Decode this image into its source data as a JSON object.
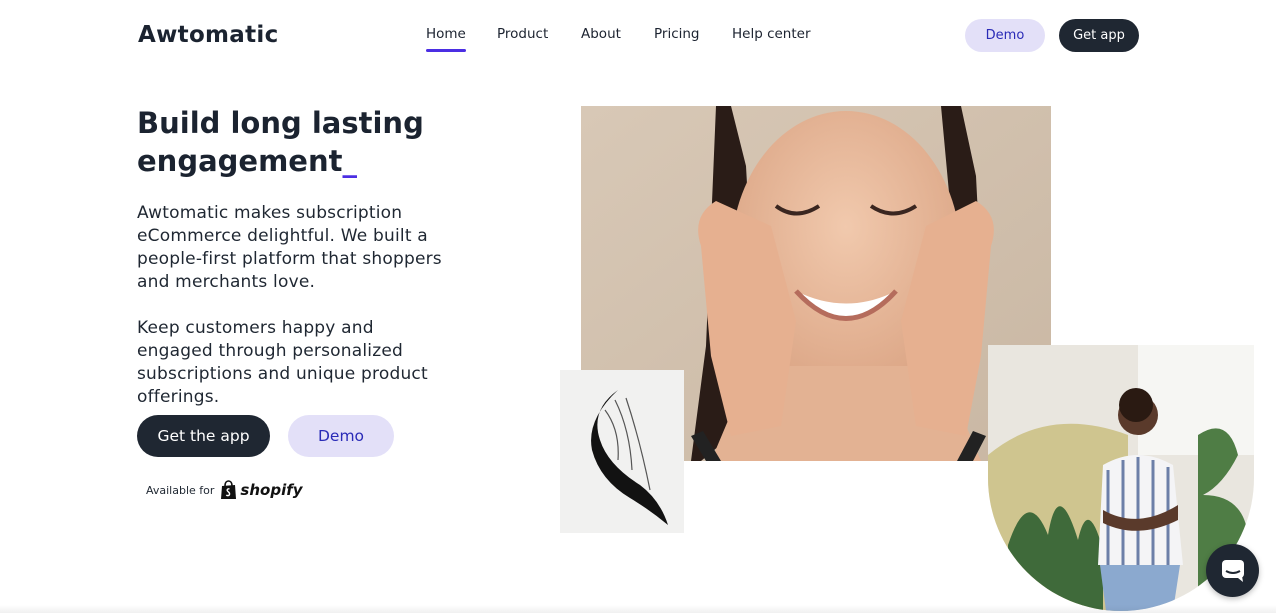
{
  "brand": {
    "logo_text": "Awtomatic",
    "accent_color": "#4b2ee3",
    "dark_color": "#1f2732",
    "soft_color": "#e3e0f8"
  },
  "nav": {
    "items": [
      {
        "label": "Home",
        "active": true
      },
      {
        "label": "Product",
        "active": false
      },
      {
        "label": "About",
        "active": false
      },
      {
        "label": "Pricing",
        "active": false
      },
      {
        "label": "Help center",
        "active": false
      }
    ],
    "demo_label": "Demo",
    "get_app_label": "Get app"
  },
  "hero": {
    "title": "Build long lasting engagement",
    "title_cursor": "_",
    "paragraph_1": "Awtomatic makes subscription eCommerce delightful. We built a people-first platform that shoppers and merchants love.",
    "paragraph_2": "Keep customers happy and engaged through personalized subscriptions and unique product offerings.",
    "cta_get_app": "Get the app",
    "cta_demo": "Demo",
    "available_label": "Available for",
    "platform_name": "shopify"
  },
  "media": {
    "main_photo": "smiling-woman-skincare-photo",
    "brush_photo": "mascara-brush-stroke-photo",
    "circle_photo": "woman-with-plants-photo"
  },
  "chat": {
    "icon": "chat-icon"
  }
}
